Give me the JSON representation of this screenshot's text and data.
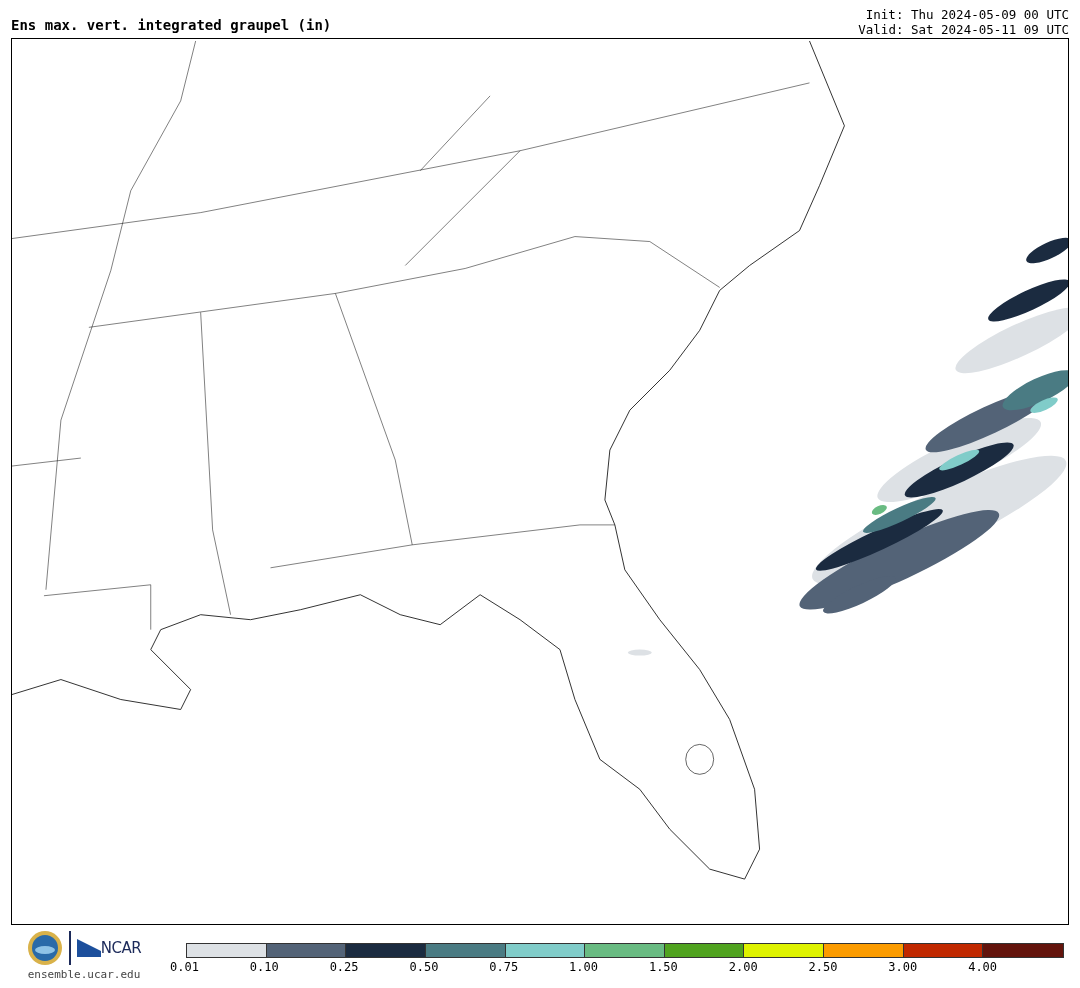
{
  "title": "Ens max. vert. integrated graupel (in)",
  "init": "Init: Thu 2024-05-09 00 UTC",
  "valid": "Valid: Sat 2024-05-11 09 UTC",
  "footer": {
    "logo_text": "NCAR",
    "url": "ensemble.ucar.edu"
  },
  "colorbar": [
    {
      "label": "0.01",
      "color": "#dde1e5"
    },
    {
      "label": "0.10",
      "color": "#536377"
    },
    {
      "label": "0.25",
      "color": "#1b2b40"
    },
    {
      "label": "0.50",
      "color": "#4a7b83"
    },
    {
      "label": "0.75",
      "color": "#80ccc9"
    },
    {
      "label": "1.00",
      "color": "#69bb82"
    },
    {
      "label": "1.50",
      "color": "#50a31f"
    },
    {
      "label": "2.00",
      "color": "#def200"
    },
    {
      "label": "2.50",
      "color": "#fb9b00"
    },
    {
      "label": "3.00",
      "color": "#c02800"
    },
    {
      "label": "4.00",
      "color": "#63140c"
    }
  ]
}
